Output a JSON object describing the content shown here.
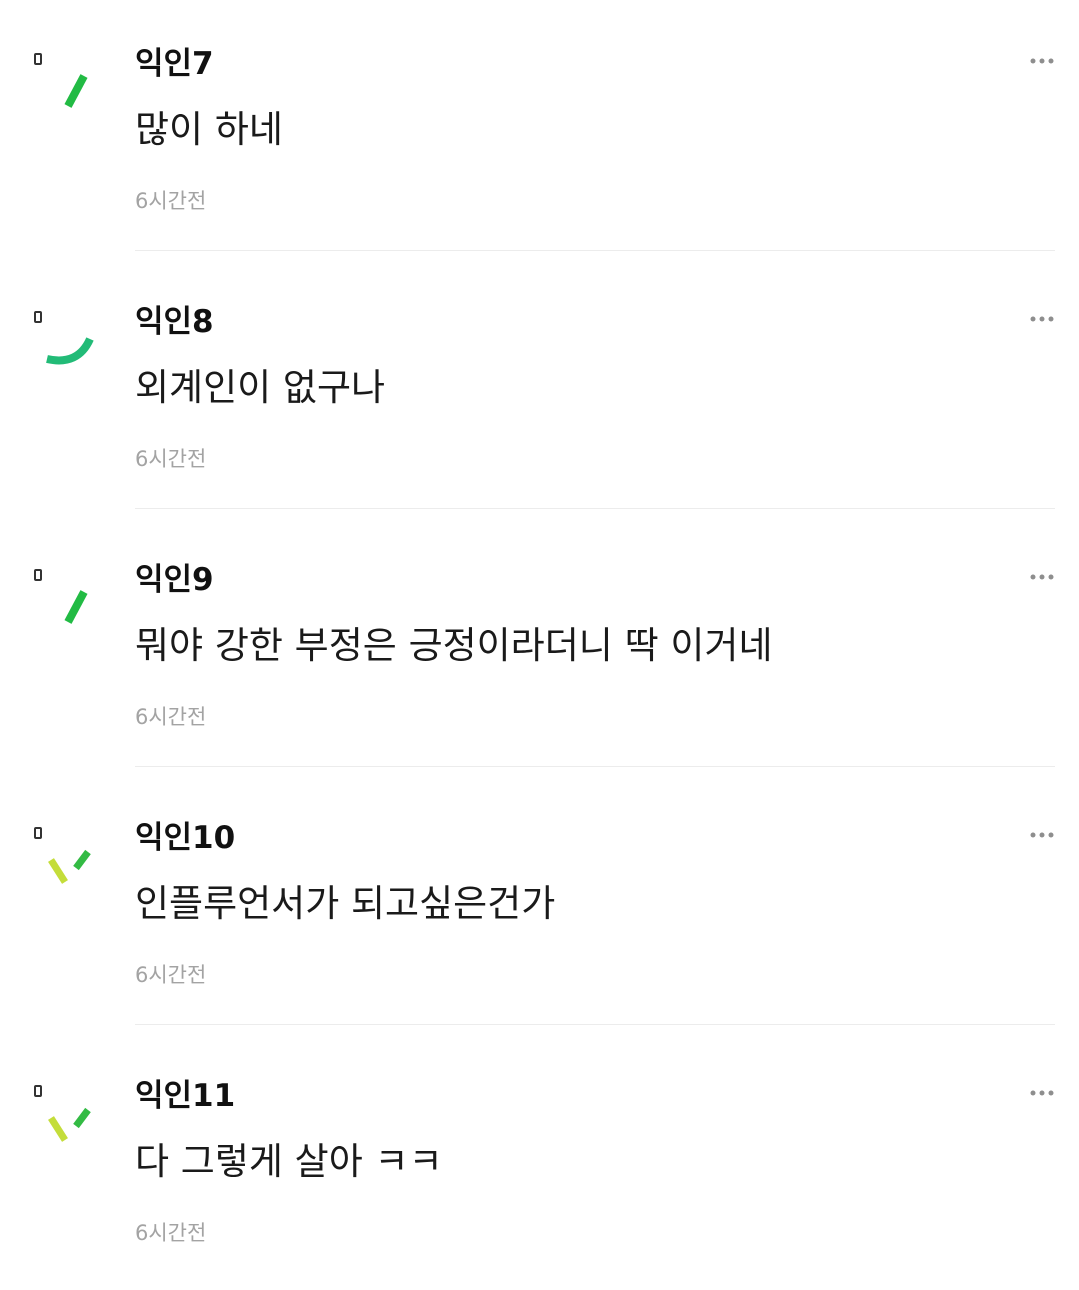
{
  "comments": [
    {
      "author": "익인7",
      "text": "많이 하네",
      "time": "6시간전",
      "avatar_icon": "green-slash-icon",
      "more_icon": "more-options-icon"
    },
    {
      "author": "익인8",
      "text": "외계인이 없구나",
      "time": "6시간전",
      "avatar_icon": "green-smile-icon",
      "more_icon": "more-options-icon"
    },
    {
      "author": "익인9",
      "text": "뭐야 강한 부정은 긍정이라더니 딱 이거네",
      "time": "6시간전",
      "avatar_icon": "green-slash-icon",
      "more_icon": "more-options-icon"
    },
    {
      "author": "익인10",
      "text": "인플루언서가 되고싶은건가",
      "time": "6시간전",
      "avatar_icon": "lime-double-dash-icon",
      "more_icon": "more-options-icon"
    },
    {
      "author": "익인11",
      "text": "다 그렇게 살아 ㅋㅋ",
      "time": "6시간전",
      "avatar_icon": "lime-double-dash-icon",
      "more_icon": "more-options-icon"
    }
  ],
  "colors": {
    "accent_green": "#22bb44",
    "accent_teal": "#22bb77",
    "accent_lime": "#c4dd3a",
    "timestamp": "#a3a3a3",
    "divider": "#ececec"
  }
}
